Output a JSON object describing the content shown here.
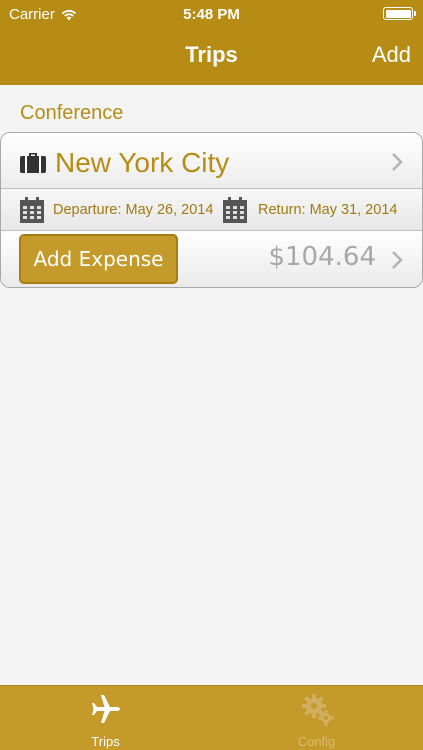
{
  "status_bar": {
    "carrier": "Carrier",
    "time": "5:48 PM",
    "battery_level": 1.0
  },
  "nav": {
    "title": "Trips",
    "add_label": "Add"
  },
  "section": {
    "title": "Conference"
  },
  "trip": {
    "destination": "New York City",
    "departure": "Departure: May 26, 2014",
    "return": "Return: May 31, 2014",
    "add_expense_label": "Add Expense",
    "total": "$104.64"
  },
  "tabs": [
    {
      "label": "Trips",
      "icon": "airplane-icon",
      "selected": true
    },
    {
      "label": "Config",
      "icon": "gears-icon",
      "selected": false
    }
  ],
  "colors": {
    "accent": "#b78c14",
    "tab_bar": "#c49a2a",
    "background": "#f4f4f4"
  }
}
